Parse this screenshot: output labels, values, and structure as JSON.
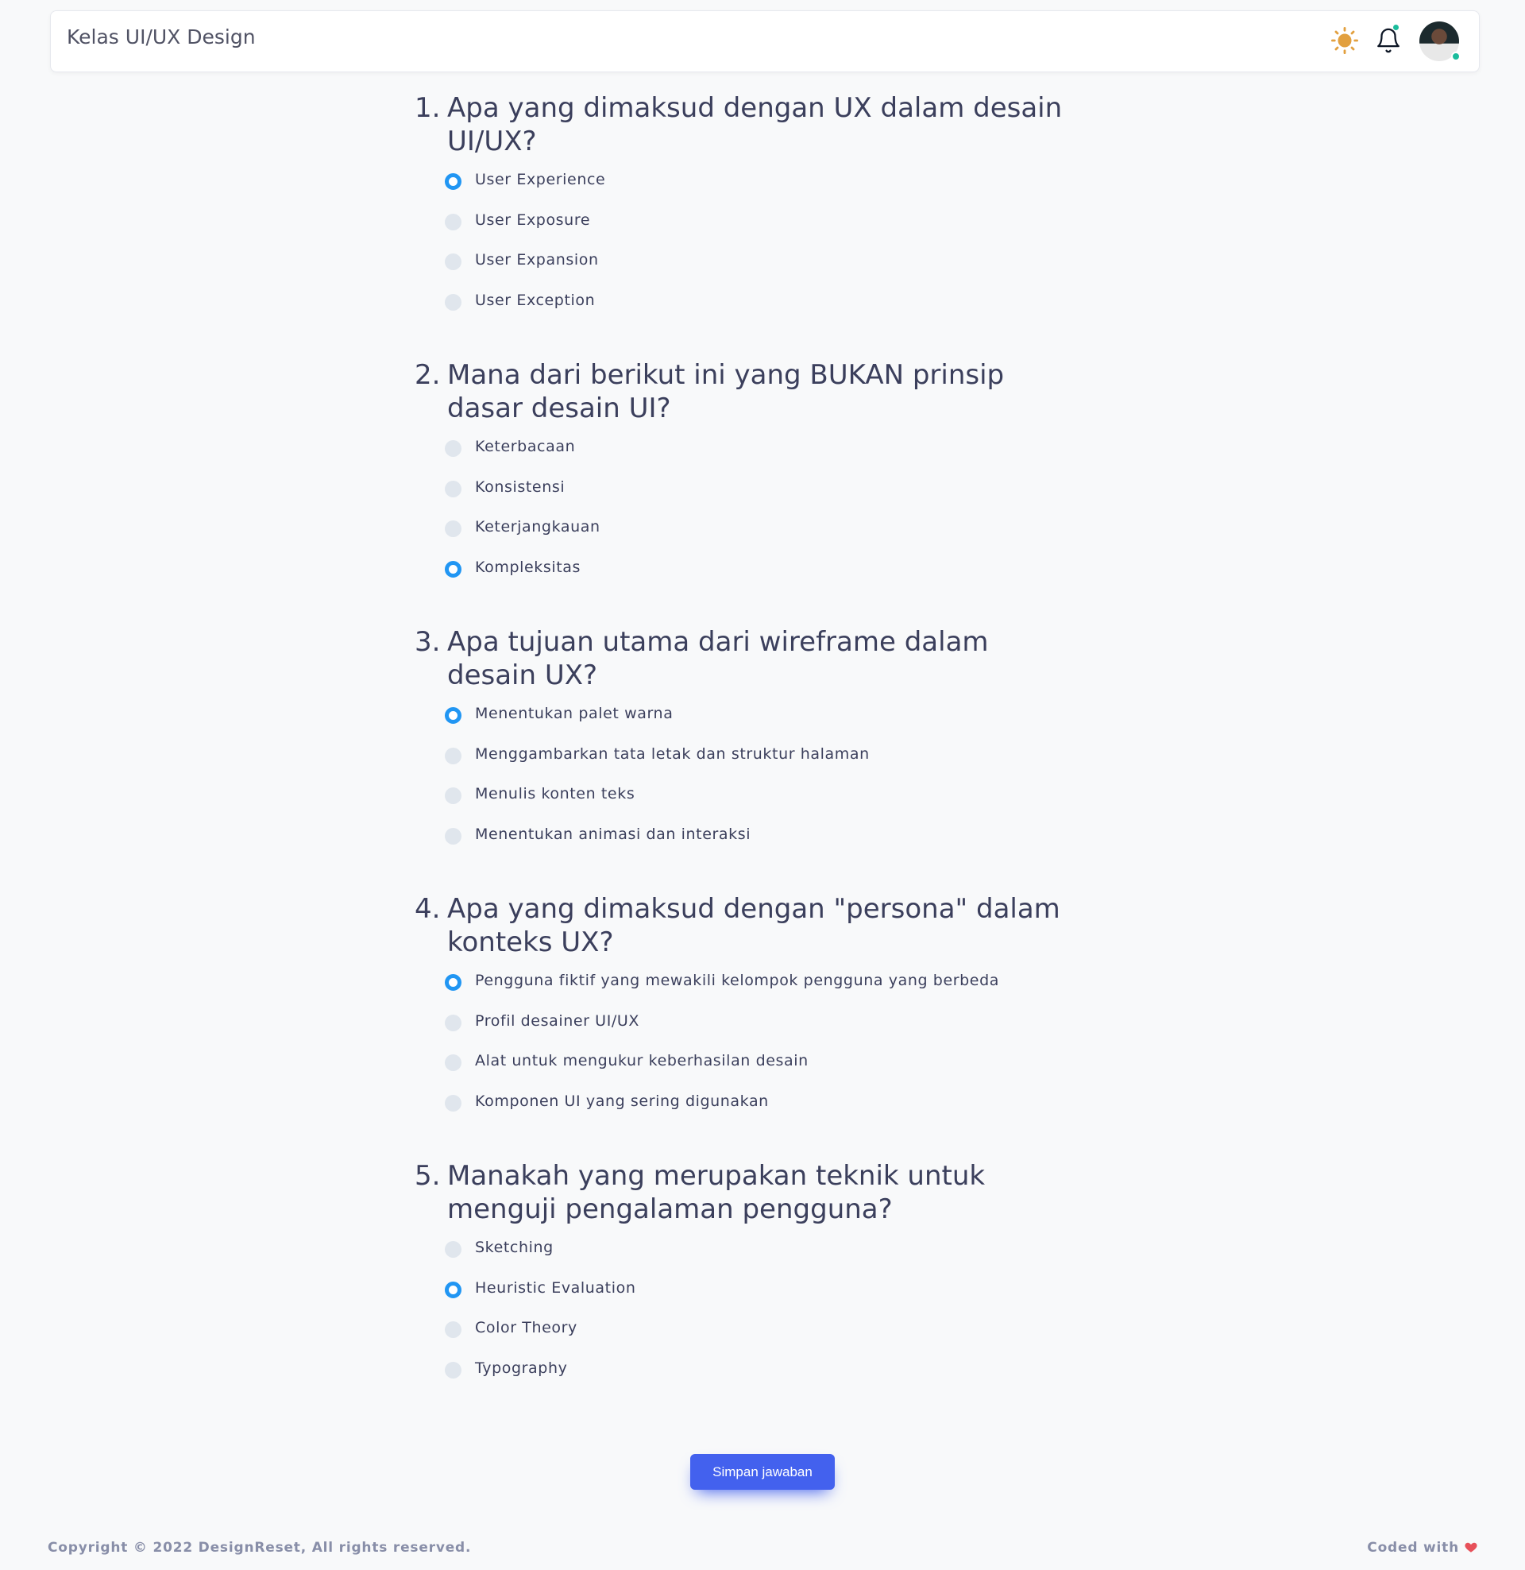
{
  "header": {
    "title": "Kelas UI/UX Design",
    "icons": [
      "sun-icon",
      "bell-icon"
    ],
    "accent_color": "#e2a03f"
  },
  "questions": [
    {
      "number": "1.",
      "text": "Apa yang dimaksud dengan UX dalam desain UI/UX?",
      "options": [
        "User Experience",
        "User Exposure",
        "User Expansion",
        "User Exception"
      ],
      "selected": 0
    },
    {
      "number": "2.",
      "text": "Mana dari berikut ini yang BUKAN prinsip dasar desain UI?",
      "options": [
        "Keterbacaan",
        "Konsistensi",
        "Keterjangkauan",
        "Kompleksitas"
      ],
      "selected": 3
    },
    {
      "number": "3.",
      "text": "Apa tujuan utama dari wireframe dalam desain UX?",
      "options": [
        "Menentukan palet warna",
        "Menggambarkan tata letak dan struktur halaman",
        "Menulis konten teks",
        "Menentukan animasi dan interaksi"
      ],
      "selected": 0
    },
    {
      "number": "4.",
      "text": "Apa yang dimaksud dengan \"persona\" dalam konteks UX?",
      "options": [
        "Pengguna fiktif yang mewakili kelompok pengguna yang berbeda",
        "Profil desainer UI/UX",
        "Alat untuk mengukur keberhasilan desain",
        "Komponen UI yang sering digunakan"
      ],
      "selected": 0
    },
    {
      "number": "5.",
      "text": "Manakah yang merupakan teknik untuk menguji pengalaman pengguna?",
      "options": [
        "Sketching",
        "Heuristic Evaluation",
        "Color Theory",
        "Typography"
      ],
      "selected": 1
    }
  ],
  "actions": {
    "save_label": "Simpan jawaban",
    "button_color": "#4361ee"
  },
  "footer": {
    "copyright": "Copyright © 2022 DesignReset, All rights reserved.",
    "coded_with": "Coded with",
    "heart_color": "#e7515a"
  },
  "radio_checked_color": "#2196f3"
}
